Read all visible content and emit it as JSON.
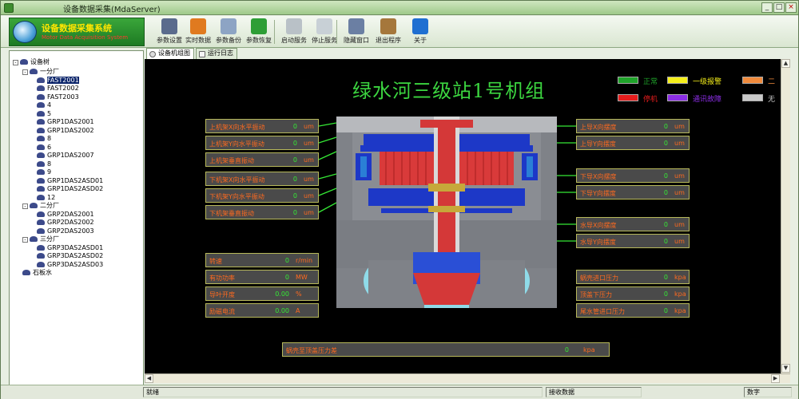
{
  "window": {
    "title": "设备数据采集(MdaServer)",
    "controls": {
      "minimize": "_",
      "maximize": "□",
      "close": "×"
    }
  },
  "logo": {
    "title": "设备数据采集系统",
    "subtitle": "Motor Data Acquisition System"
  },
  "toolbar": [
    {
      "label": "参数设置",
      "icon": "settings-icon",
      "color": "#5a6b8c"
    },
    {
      "label": "实时数据",
      "icon": "realtime-data-icon",
      "color": "#e07a1f"
    },
    {
      "label": "参数备份",
      "icon": "backup-icon",
      "color": "#8da4c4"
    },
    {
      "label": "参数恢复",
      "icon": "restore-icon",
      "color": "#2e9e36"
    },
    {
      "label": "启动服务",
      "icon": "start-service-icon",
      "color": "#b9c1c7"
    },
    {
      "label": "停止服务",
      "icon": "stop-service-icon",
      "color": "#c8d0d6"
    },
    {
      "label": "隐藏窗口",
      "icon": "hide-window-icon",
      "color": "#6b7fa3"
    },
    {
      "label": "退出程序",
      "icon": "exit-icon",
      "color": "#a5773c"
    },
    {
      "label": "关于",
      "icon": "help-icon",
      "color": "#1f6fd1"
    }
  ],
  "tree": {
    "root": "设备树",
    "nodes": [
      {
        "label": "一分厂",
        "level": 1,
        "branch": true
      },
      {
        "label": "FAST2001",
        "level": 2,
        "selected": true
      },
      {
        "label": "FAST2002",
        "level": 2
      },
      {
        "label": "FAST2003",
        "level": 2
      },
      {
        "label": "4",
        "level": 2
      },
      {
        "label": "5",
        "level": 2
      },
      {
        "label": "GRP1DAS2001",
        "level": 2
      },
      {
        "label": "GRP1DAS2002",
        "level": 2
      },
      {
        "label": "8",
        "level": 2
      },
      {
        "label": "6",
        "level": 2
      },
      {
        "label": "GRP1DAS2007",
        "level": 2
      },
      {
        "label": "8",
        "level": 2
      },
      {
        "label": "9",
        "level": 2
      },
      {
        "label": "GRP1DAS2ASD01",
        "level": 2
      },
      {
        "label": "GRP1DAS2ASD02",
        "level": 2
      },
      {
        "label": "12",
        "level": 2
      },
      {
        "label": "二分厂",
        "level": 1,
        "branch": true
      },
      {
        "label": "GRP2DAS2001",
        "level": 2
      },
      {
        "label": "GRP2DAS2002",
        "level": 2
      },
      {
        "label": "GRP2DAS2003",
        "level": 2
      },
      {
        "label": "三分厂",
        "level": 1,
        "branch": true
      },
      {
        "label": "GRP3DAS2ASD01",
        "level": 2
      },
      {
        "label": "GRP3DAS2ASD02",
        "level": 2
      },
      {
        "label": "GRP3DAS2ASD03",
        "level": 2
      },
      {
        "label": "石板水",
        "level": 1
      }
    ]
  },
  "tabs": [
    {
      "label": "设备机组图",
      "active": true
    },
    {
      "label": "运行日志",
      "active": false
    }
  ],
  "diagram": {
    "title": "绿水河三级站1号机组",
    "legend": [
      {
        "label": "正常",
        "color": "#1fa32a"
      },
      {
        "label": "一级报警",
        "color": "#f5ef1a"
      },
      {
        "label": "二",
        "color": "#f08a3c"
      },
      {
        "label": "停机",
        "color": "#e61d1d"
      },
      {
        "label": "通讯故障",
        "color": "#8c2ee6"
      },
      {
        "label": "无",
        "color": "#c9c9c9"
      }
    ],
    "left_sensors": [
      {
        "name": "上机架X向水平振动",
        "value": "0",
        "unit": "um"
      },
      {
        "name": "上机架Y向水平振动",
        "value": "0",
        "unit": "um"
      },
      {
        "name": "上机架垂直振动",
        "value": "0",
        "unit": "um"
      },
      {
        "name": "下机架X向水平振动",
        "value": "0",
        "unit": "um"
      },
      {
        "name": "下机架Y向水平振动",
        "value": "0",
        "unit": "um"
      },
      {
        "name": "下机架垂直振动",
        "value": "0",
        "unit": "um"
      }
    ],
    "right_sensors": [
      {
        "name": "上导X向摆度",
        "value": "0",
        "unit": "um"
      },
      {
        "name": "上导Y向摆度",
        "value": "0",
        "unit": "um"
      },
      {
        "name": "下导X向摆度",
        "value": "0",
        "unit": "um"
      },
      {
        "name": "下导Y向摆度",
        "value": "0",
        "unit": "um"
      },
      {
        "name": "水导X向摆度",
        "value": "0",
        "unit": "um"
      },
      {
        "name": "水导Y向摆度",
        "value": "0",
        "unit": "um"
      }
    ],
    "left_status": [
      {
        "name": "转速",
        "value": "0",
        "unit": "r/min"
      },
      {
        "name": "有功功率",
        "value": "0",
        "unit": "MW"
      },
      {
        "name": "导叶开度",
        "value": "0.00",
        "unit": "%"
      },
      {
        "name": "励磁电流",
        "value": "0.00",
        "unit": "A"
      }
    ],
    "right_status": [
      {
        "name": "蜗壳进口压力",
        "value": "0",
        "unit": "kpa"
      },
      {
        "name": "顶盖下压力",
        "value": "0",
        "unit": "kpa"
      },
      {
        "name": "尾水管进口压力",
        "value": "0",
        "unit": "kpa"
      }
    ],
    "bottom": {
      "name": "蜗壳至顶盖压力差",
      "value": "0",
      "unit": "kpa"
    }
  },
  "statusbar": {
    "left": "就绪",
    "middle": "接收数据",
    "right": "数字"
  }
}
